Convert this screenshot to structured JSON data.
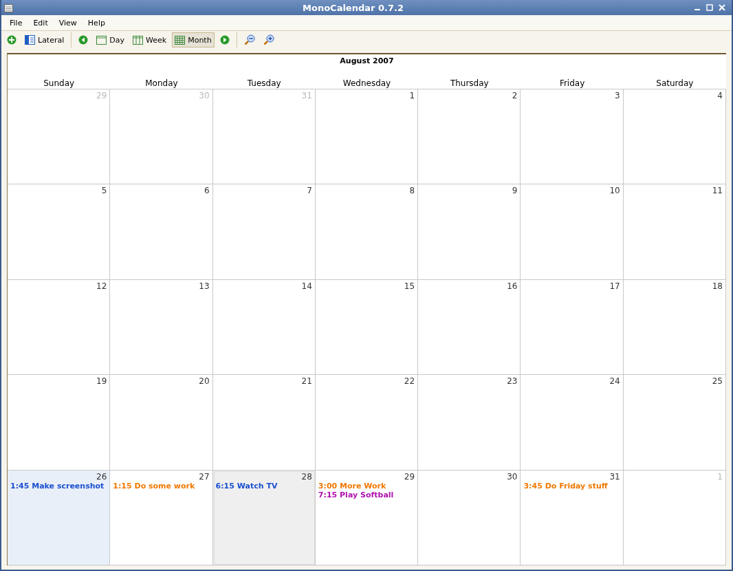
{
  "window": {
    "title": "MonoCalendar 0.7.2"
  },
  "menu": [
    "File",
    "Edit",
    "View",
    "Help"
  ],
  "toolbar": [
    {
      "kind": "add"
    },
    {
      "kind": "lateral",
      "label": "Lateral",
      "selected": false
    },
    {
      "kind": "separator"
    },
    {
      "kind": "prev"
    },
    {
      "kind": "day",
      "label": "Day",
      "selected": false
    },
    {
      "kind": "week",
      "label": "Week",
      "selected": false
    },
    {
      "kind": "month",
      "label": "Month",
      "selected": true
    },
    {
      "kind": "next"
    },
    {
      "kind": "separator"
    },
    {
      "kind": "zoom-out"
    },
    {
      "kind": "zoom-in"
    }
  ],
  "calendar": {
    "title": "August 2007",
    "weekdays": [
      "Sunday",
      "Monday",
      "Tuesday",
      "Wednesday",
      "Thursday",
      "Friday",
      "Saturday"
    ],
    "weeks": [
      [
        {
          "day": "29",
          "other_month": true
        },
        {
          "day": "30",
          "other_month": true
        },
        {
          "day": "31",
          "other_month": true
        },
        {
          "day": "1",
          "other_month": false
        },
        {
          "day": "2",
          "other_month": false
        },
        {
          "day": "3",
          "other_month": false
        },
        {
          "day": "4",
          "other_month": false
        }
      ],
      [
        {
          "day": "5",
          "other_month": false
        },
        {
          "day": "6",
          "other_month": false
        },
        {
          "day": "7",
          "other_month": false
        },
        {
          "day": "8",
          "other_month": false
        },
        {
          "day": "9",
          "other_month": false
        },
        {
          "day": "10",
          "other_month": false
        },
        {
          "day": "11",
          "other_month": false
        }
      ],
      [
        {
          "day": "12",
          "other_month": false
        },
        {
          "day": "13",
          "other_month": false
        },
        {
          "day": "14",
          "other_month": false
        },
        {
          "day": "15",
          "other_month": false
        },
        {
          "day": "16",
          "other_month": false
        },
        {
          "day": "17",
          "other_month": false
        },
        {
          "day": "18",
          "other_month": false
        }
      ],
      [
        {
          "day": "19",
          "other_month": false
        },
        {
          "day": "20",
          "other_month": false
        },
        {
          "day": "21",
          "other_month": false
        },
        {
          "day": "22",
          "other_month": false
        },
        {
          "day": "23",
          "other_month": false
        },
        {
          "day": "24",
          "other_month": false
        },
        {
          "day": "25",
          "other_month": false
        }
      ],
      [
        {
          "day": "26",
          "other_month": false,
          "today": true,
          "events": [
            {
              "time": "1:45",
              "title": "Make screenshot",
              "color": "#1a4fd0"
            }
          ]
        },
        {
          "day": "27",
          "other_month": false,
          "events": [
            {
              "time": "1:15",
              "title": "Do some work",
              "color": "#f07800"
            }
          ]
        },
        {
          "day": "28",
          "other_month": false,
          "selected": true,
          "events": [
            {
              "time": "6:15",
              "title": "Watch TV",
              "color": "#1a4fd0"
            }
          ]
        },
        {
          "day": "29",
          "other_month": false,
          "events": [
            {
              "time": "3:00",
              "title": "More Work",
              "color": "#f07800"
            },
            {
              "time": "7:15",
              "title": "Play Softball",
              "color": "#b010b0"
            }
          ]
        },
        {
          "day": "30",
          "other_month": false
        },
        {
          "day": "31",
          "other_month": false,
          "events": [
            {
              "time": "3:45",
              "title": "Do Friday stuff",
              "color": "#f07800"
            }
          ]
        },
        {
          "day": "1",
          "other_month": true
        }
      ]
    ]
  }
}
